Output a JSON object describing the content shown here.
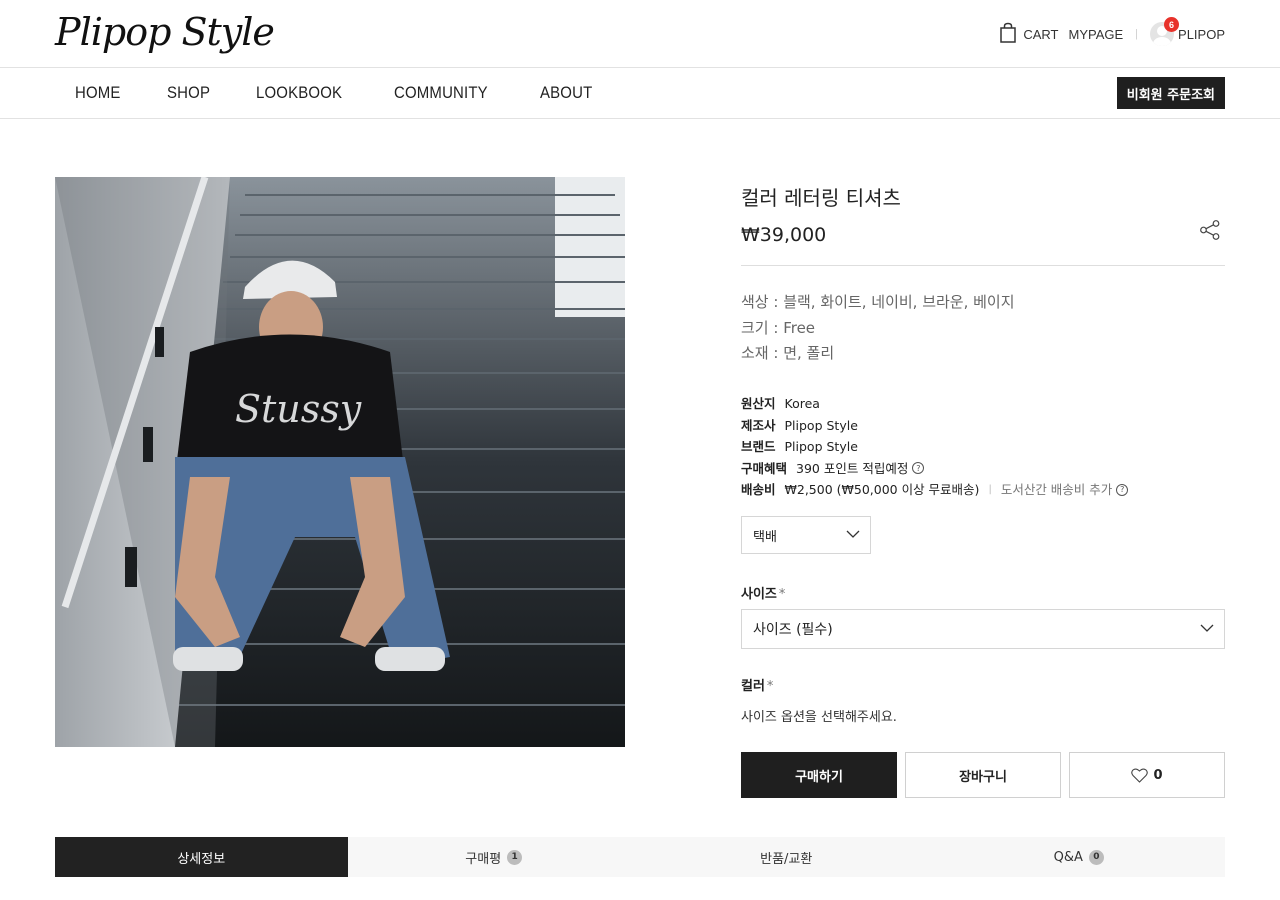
{
  "header": {
    "logo": "Plipop Style",
    "cart_label": "CART",
    "mypage_label": "MYPAGE",
    "separator": "|",
    "user_name": "PLIPOP",
    "notification_count": "6",
    "icons": {
      "cart": "shopping-bag-icon",
      "avatar": "user-avatar-icon"
    }
  },
  "nav": {
    "items": [
      "HOME",
      "SHOP",
      "LOOKBOOK",
      "COMMUNITY",
      "ABOUT"
    ],
    "guest_order_button": "비회원 주문조회"
  },
  "product": {
    "image_alt": "Man in cap and black graphic tee sitting on stairs",
    "title": "컬러 레터링 티셔츠",
    "price": "₩39,000",
    "description": [
      "색상 : 블랙, 화이트, 네이비, 브라운, 베이지",
      "크기 : Free",
      "소재 : 면, 폴리"
    ],
    "specs": {
      "origin_label": "원산지",
      "origin_value": "Korea",
      "maker_label": "제조사",
      "maker_value": "Plipop Style",
      "brand_label": "브랜드",
      "brand_value": "Plipop Style",
      "benefit_label": "구매혜택",
      "benefit_value": "390 포인트 적립예정",
      "shipping_label": "배송비",
      "shipping_value": "₩2,500 (₩50,000 이상 무료배송)",
      "shipping_separator": "|",
      "shipping_extra": "도서산간 배송비 추가",
      "help_glyph": "?"
    },
    "shipping_method": {
      "selected": "택배"
    },
    "size_option": {
      "label": "사이즈",
      "required_mark": "*",
      "selected": "사이즈 (필수)"
    },
    "color_option": {
      "label": "컬러",
      "required_mark": "*",
      "message": "사이즈 옵션을 선택해주세요."
    },
    "buttons": {
      "buy": "구매하기",
      "cart": "장바구니",
      "like_count": "0"
    }
  },
  "tabs": [
    {
      "label": "상세정보",
      "count": ""
    },
    {
      "label": "구매평",
      "count": "1"
    },
    {
      "label": "반품/교환",
      "count": ""
    },
    {
      "label": "Q&A",
      "count": "0"
    }
  ],
  "colors": {
    "dark": "#1f1f1f",
    "badge": "#e8322b",
    "border": "#d6d6d6",
    "tab_bg": "#f7f7f7"
  }
}
